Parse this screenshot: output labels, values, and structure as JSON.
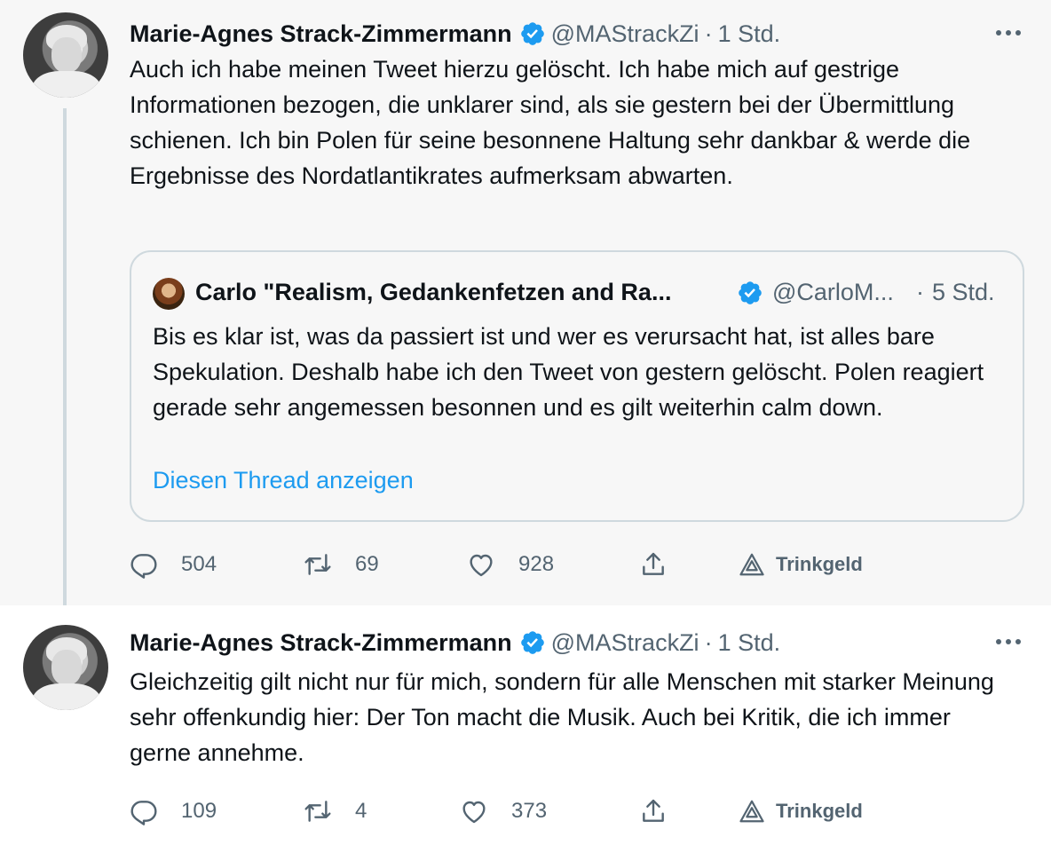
{
  "tweets": [
    {
      "name": "Marie-Agnes Strack-Zimmermann",
      "handle": "@MAStrackZi",
      "separator": "·",
      "time": "1 Std.",
      "text": "Auch ich habe meinen Tweet hierzu gelöscht. Ich habe mich auf gestrige Informationen bezogen, die unklarer sind, als sie gestern bei der Übermittlung schienen. Ich bin Polen für seine besonnene Haltung sehr dankbar & werde die Ergebnisse des Nordatlantikrates aufmerksam abwarten.",
      "quote": {
        "name": "Carlo \"Realism, Gedankenfetzen and Ra...",
        "handle": "@CarloM...",
        "separator": "·",
        "time": "5 Std.",
        "text": "Bis es klar ist, was da passiert ist und wer es verursacht hat, ist alles bare Spekulation. Deshalb habe ich den Tweet von gestern gelöscht. Polen reagiert gerade sehr angemessen besonnen und es gilt weiterhin calm down.",
        "thread_link": "Diesen Thread anzeigen"
      },
      "replies": "504",
      "retweets": "69",
      "likes": "928",
      "tip_label": "Trinkgeld"
    },
    {
      "name": "Marie-Agnes Strack-Zimmermann",
      "handle": "@MAStrackZi",
      "separator": "·",
      "time": "1 Std.",
      "text": "Gleichzeitig gilt nicht nur für mich, sondern für alle Menschen mit starker Meinung sehr offenkundig hier: Der Ton macht die Musik. Auch bei Kritik, die ich immer gerne annehme.",
      "replies": "109",
      "retweets": "4",
      "likes": "373",
      "tip_label": "Trinkgeld"
    }
  ],
  "colors": {
    "verified": "#1d9bf0",
    "link": "#1d9bf0",
    "muted": "#536471",
    "highlight_bg": "#f7f7f7"
  },
  "icons": [
    "verified-badge-icon",
    "more-icon",
    "reply-icon",
    "retweet-icon",
    "like-icon",
    "share-icon",
    "tip-icon"
  ]
}
